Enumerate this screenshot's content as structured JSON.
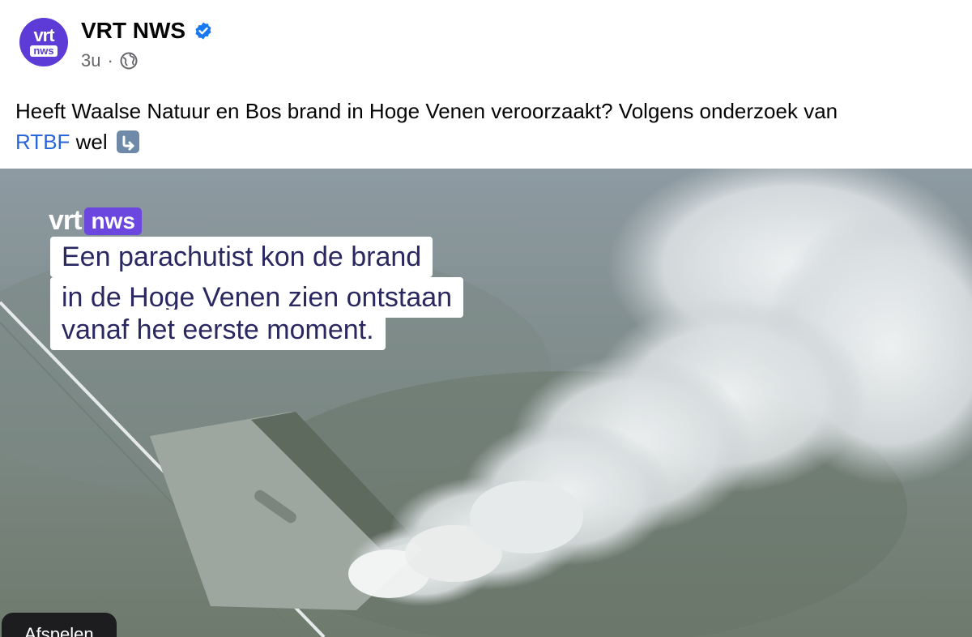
{
  "post": {
    "page_name": "VRT NWS",
    "verified": true,
    "time": "3u",
    "separator": "·",
    "avatar": {
      "line1": "vrt",
      "line2": "nws"
    },
    "caption_before_link": "Heeft Waalse Natuur en Bos brand in Hoge Venen veroorzaakt? Volgens onderzoek van",
    "caption_link": "RTBF",
    "caption_after_link": "wel",
    "emoji": "down-right-arrow"
  },
  "video": {
    "logo_text": "vrt",
    "logo_badge": "nws",
    "overlay_lines": [
      "Een parachutist kon de brand",
      "in de Hoge Venen zien ontstaan",
      "vanaf het eerste moment."
    ],
    "play_label": "Afspelen"
  },
  "colors": {
    "brand_purple": "#5c3bd6",
    "link_blue": "#2966d8",
    "verified_blue": "#1877f2"
  }
}
